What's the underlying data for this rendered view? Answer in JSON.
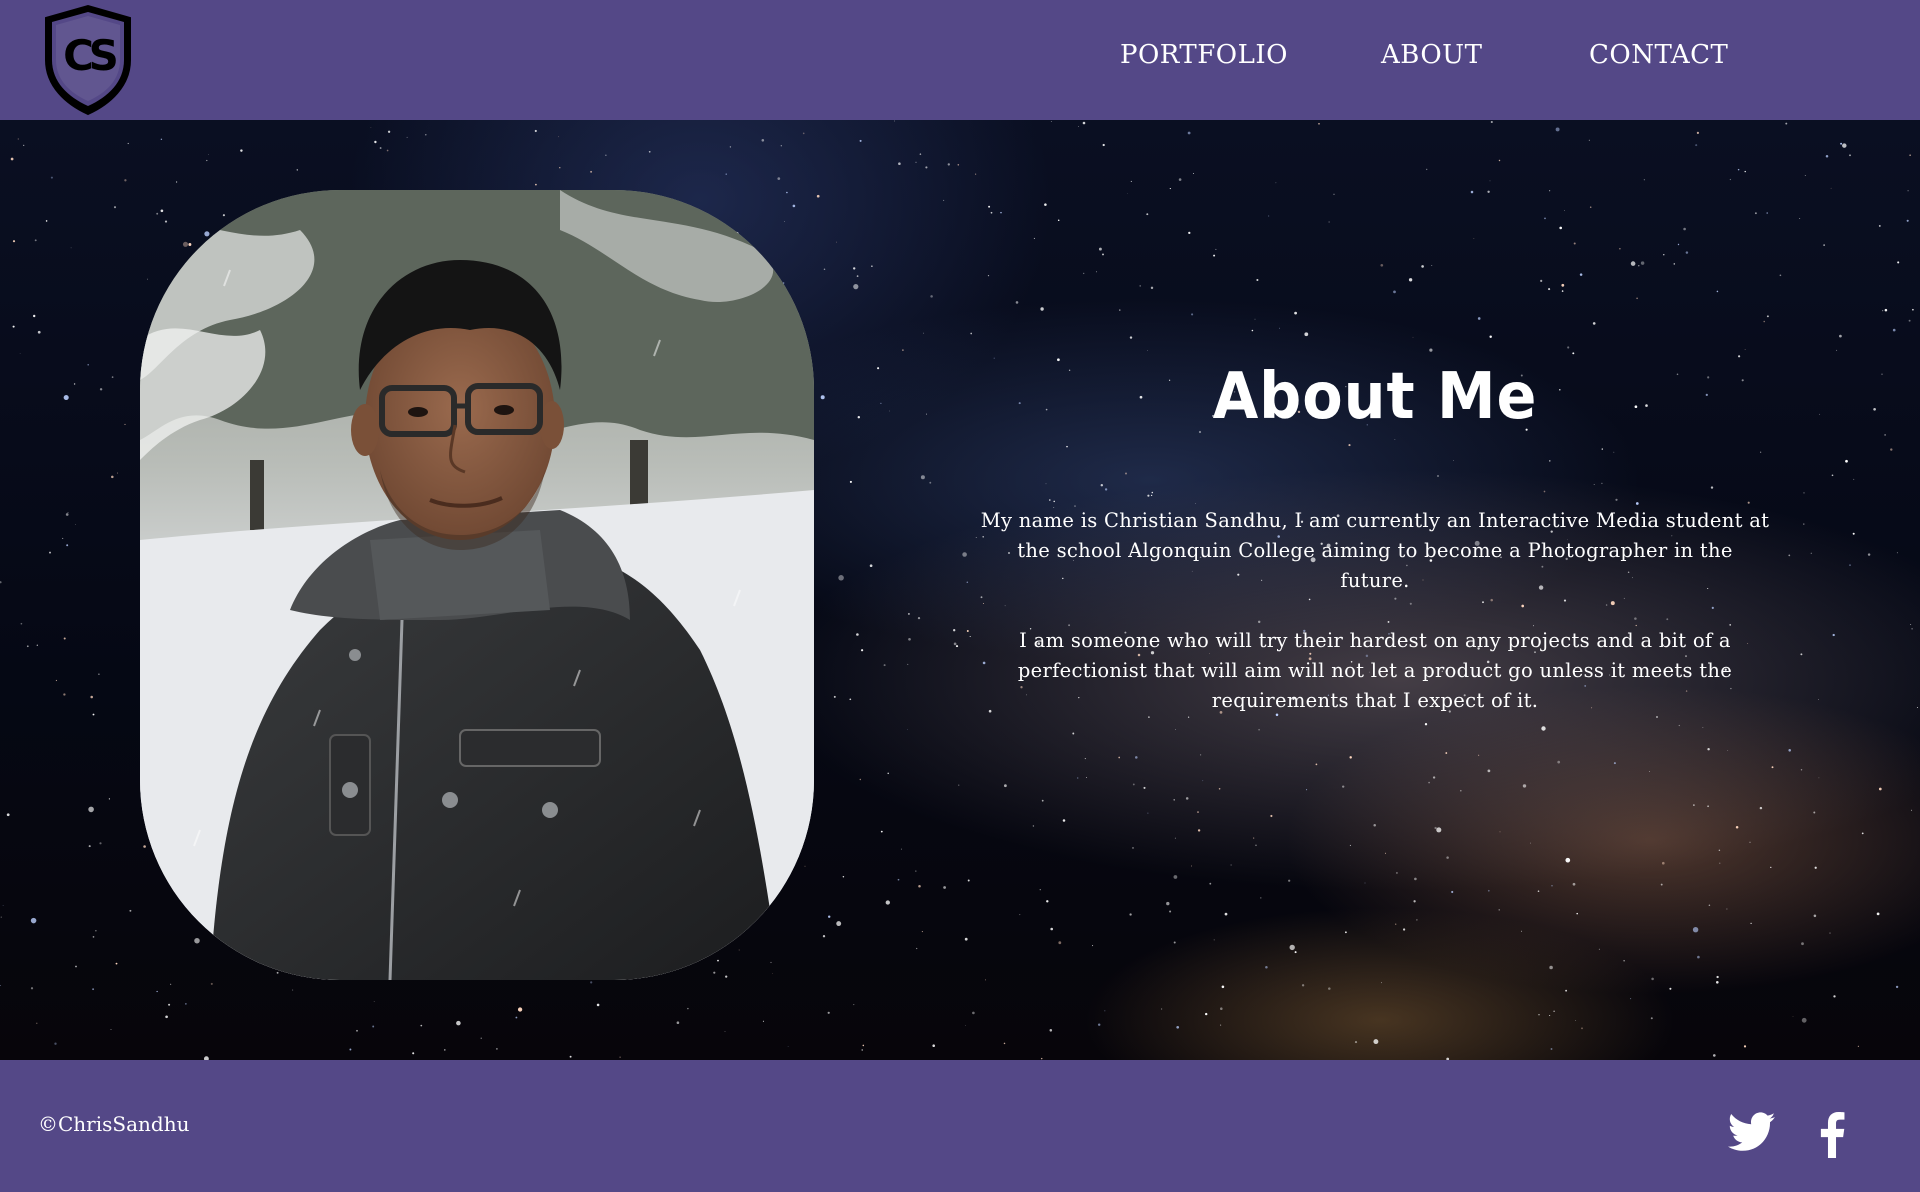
{
  "header": {
    "logo_text": "CS",
    "nav": [
      {
        "label": "PORTFOLIO"
      },
      {
        "label": "ABOUT"
      },
      {
        "label": "CONTACT"
      }
    ]
  },
  "about": {
    "title": "About Me",
    "paragraph1": "My name is Christian Sandhu, I am currently an Interactive Media student at the school Algonquin College aiming to become a Photographer in the future.",
    "paragraph2": "I am someone who will try their hardest on any projects and a bit of a perfectionist that will aim will not let a product go unless it meets the requirements that I expect of it."
  },
  "footer": {
    "copyright": "©ChrisSandhu",
    "social": [
      {
        "icon": "twitter-icon"
      },
      {
        "icon": "facebook-icon"
      }
    ]
  },
  "colors": {
    "brand_purple": "#544887",
    "text": "#ffffff"
  }
}
